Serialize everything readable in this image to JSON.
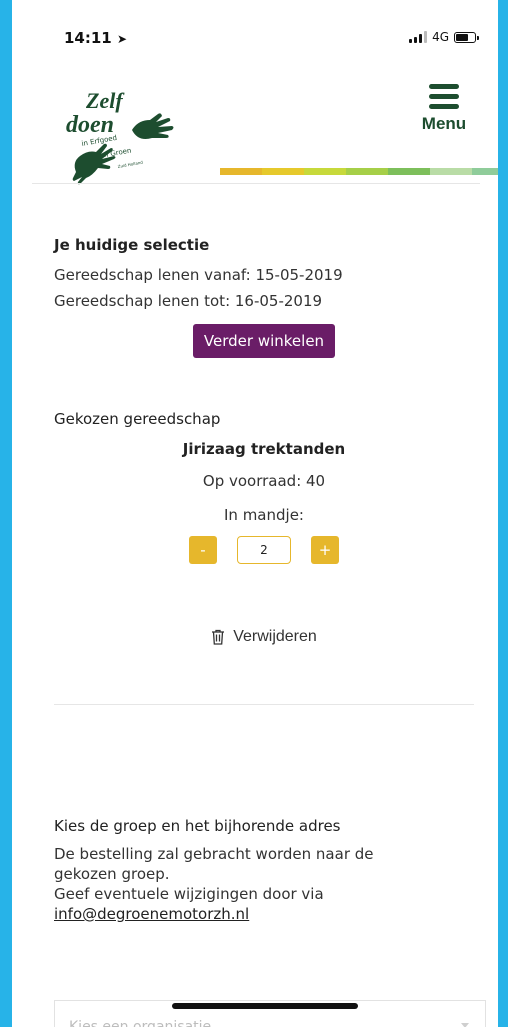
{
  "status_bar": {
    "time": "14:11",
    "network": "4G"
  },
  "header": {
    "menu_label": "Menu",
    "stripe_colors": [
      "#e6b72c",
      "#e6c92c",
      "#c7d93b",
      "#a6cf48",
      "#7dbf5b",
      "#b9dca6",
      "#8fcc9a"
    ]
  },
  "logo": {
    "line1": "Zelf",
    "line2": "doen",
    "line3": "in Erfgoed",
    "line4": "en Groen",
    "line5": "Zuid Holland",
    "color": "#1d4d2f"
  },
  "selection": {
    "title": "Je huidige selectie",
    "from_line": "Gereedschap lenen vanaf: 15-05-2019",
    "to_line": "Gereedschap lenen tot: 16-05-2019",
    "continue_button": "Verder winkelen"
  },
  "chosen": {
    "title": "Gekozen gereedschap",
    "item_name": "Jirizaag trektanden",
    "stock_line": "Op voorraad: 40",
    "cart_label": "In mandje:",
    "minus": "-",
    "quantity": "2",
    "plus": "+",
    "remove_label": "Verwijderen"
  },
  "group": {
    "title": "Kies de groep en het bijhorende adres",
    "desc1": "De bestelling zal gebracht worden naar de",
    "desc2": "gekozen groep.",
    "desc3": "Geef eventuele wijzigingen door via",
    "email": "info@degroenemotorzh.nl",
    "select_placeholder": "Kies een organisatie"
  },
  "colors": {
    "accent_purple": "#6a1d67",
    "accent_yellow": "#e6b72c",
    "brand_green": "#1d4d2f",
    "background_blue": "#27b3e8"
  }
}
